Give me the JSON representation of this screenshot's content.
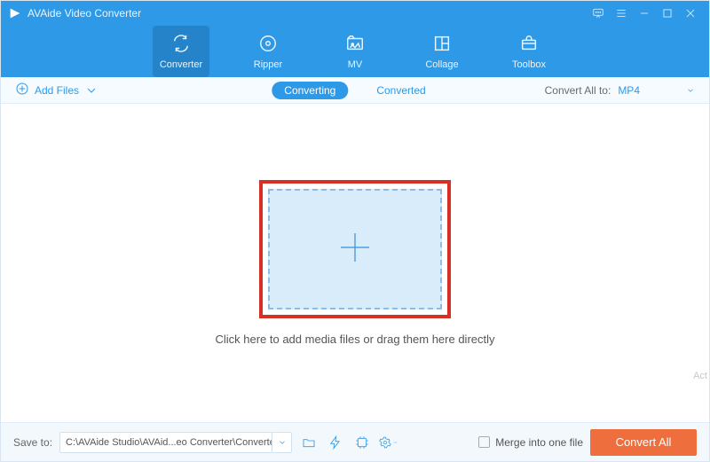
{
  "titlebar": {
    "title": "AVAide Video Converter"
  },
  "nav": {
    "items": [
      {
        "label": "Converter"
      },
      {
        "label": "Ripper"
      },
      {
        "label": "MV"
      },
      {
        "label": "Collage"
      },
      {
        "label": "Toolbox"
      }
    ]
  },
  "toolbar": {
    "add_files_label": "Add Files",
    "subtabs": {
      "converting": "Converting",
      "converted": "Converted"
    },
    "convert_all_label": "Convert All to:",
    "convert_all_value": "MP4"
  },
  "main": {
    "hint": "Click here to add media files or drag them here directly"
  },
  "bottom": {
    "saveto_label": "Save to:",
    "saveto_path": "C:\\AVAide Studio\\AVAid...eo Converter\\Converted",
    "merge_label": "Merge into one file",
    "convert_button": "Convert All",
    "watermark": "Act"
  },
  "icons": {
    "logo": "avaide-logo",
    "feedback": "feedback-icon",
    "menu": "menu-icon",
    "minimize": "minimize-icon",
    "maximize": "maximize-icon",
    "close": "close-icon"
  },
  "colors": {
    "brand": "#2e99e6",
    "accent": "#ee6e3d",
    "highlight_frame": "#d93025"
  }
}
